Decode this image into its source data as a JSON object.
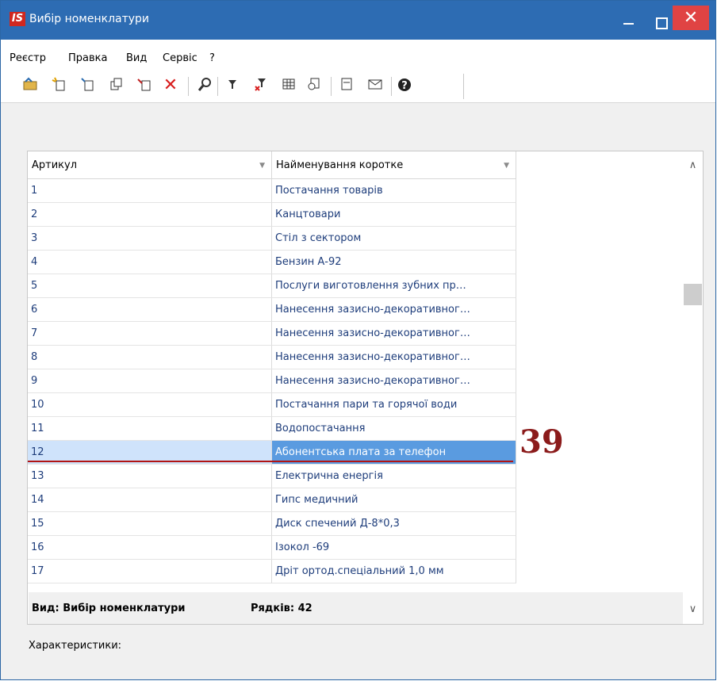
{
  "window": {
    "title": "Вибір номенклатури",
    "logo_text": "IS"
  },
  "menu": [
    "Реєстр",
    "Правка",
    "Вид",
    "Сервіс",
    "?"
  ],
  "toolbar": {
    "icons": [
      "open-folder-icon",
      "new-item-icon",
      "new-subitem-icon",
      "copy-icon",
      "edit-icon",
      "delete-icon",
      "search-icon",
      "filter-icon",
      "clear-filter-icon",
      "table-icon",
      "export-icon",
      "document-icon",
      "mail-icon",
      "help-icon"
    ]
  },
  "grid": {
    "columns": [
      "Артикул",
      "Найменування коротке"
    ],
    "rows": [
      [
        "1",
        "Постачання товарів"
      ],
      [
        "2",
        "Канцтовари"
      ],
      [
        "3",
        "Стіл з сектором"
      ],
      [
        "4",
        "Бензин А-92"
      ],
      [
        "5",
        "Послуги виготовлення зубних пр…"
      ],
      [
        "6",
        "Нанесення зазисно-декоративног…"
      ],
      [
        "7",
        "Нанесення зазисно-декоративног…"
      ],
      [
        "8",
        "Нанесення зазисно-декоративног…"
      ],
      [
        "9",
        "Нанесення зазисно-декоративног…"
      ],
      [
        "10",
        "Постачання пари та горячої води"
      ],
      [
        "11",
        "Водопостачання"
      ],
      [
        "12",
        "Абонентська плата за телефон"
      ],
      [
        "13",
        "Електрична енергія"
      ],
      [
        "14",
        "Гипс медичний"
      ],
      [
        "15",
        "Диск спечений Д-8*0,3"
      ],
      [
        "16",
        "Ізокол -69"
      ],
      [
        "17",
        "Дріт ортод.спеціальний 1,0 мм"
      ]
    ],
    "selected_row": 11
  },
  "annotation": {
    "label": "39"
  },
  "footer": {
    "view_label": "Вид: Вибір номенклатури",
    "rows_label": "Рядків: 42"
  },
  "characteristics_label": "Характеристики:",
  "colors": {
    "titlebar": "#2d6cb3",
    "selected_row": "#5a9be0",
    "close_button": "#e04343",
    "annotation": "#8b1b1b"
  }
}
